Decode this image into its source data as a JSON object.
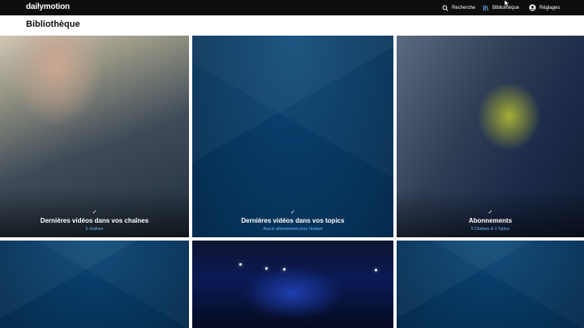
{
  "header": {
    "logo": "dailymotion",
    "nav": {
      "search": "Recherche",
      "library": "Bibliothèque",
      "settings": "Réglages"
    }
  },
  "page": {
    "title": "Bibliothèque"
  },
  "cards": [
    {
      "title": "Dernières vidéos dans vos chaînes",
      "subtitle": "5 chaînes",
      "image": "bike-jersey-photo"
    },
    {
      "title": "Dernières vidéos dans vos topics",
      "subtitle": "Aucun abonnement pour l'instant",
      "image": "blue-pattern"
    },
    {
      "title": "Abonnements",
      "subtitle": "5 Chaînes & 0 Topics",
      "image": "bicycle-photo"
    },
    {
      "title": "",
      "subtitle": "",
      "image": "blue-pattern"
    },
    {
      "title": "",
      "subtitle": "",
      "image": "concert-photo"
    },
    {
      "title": "",
      "subtitle": "",
      "image": "blue-pattern"
    }
  ],
  "colors": {
    "topbar": "#0d0d0d",
    "accent_link": "#6fb9ff",
    "card_blue": "#083b66"
  }
}
